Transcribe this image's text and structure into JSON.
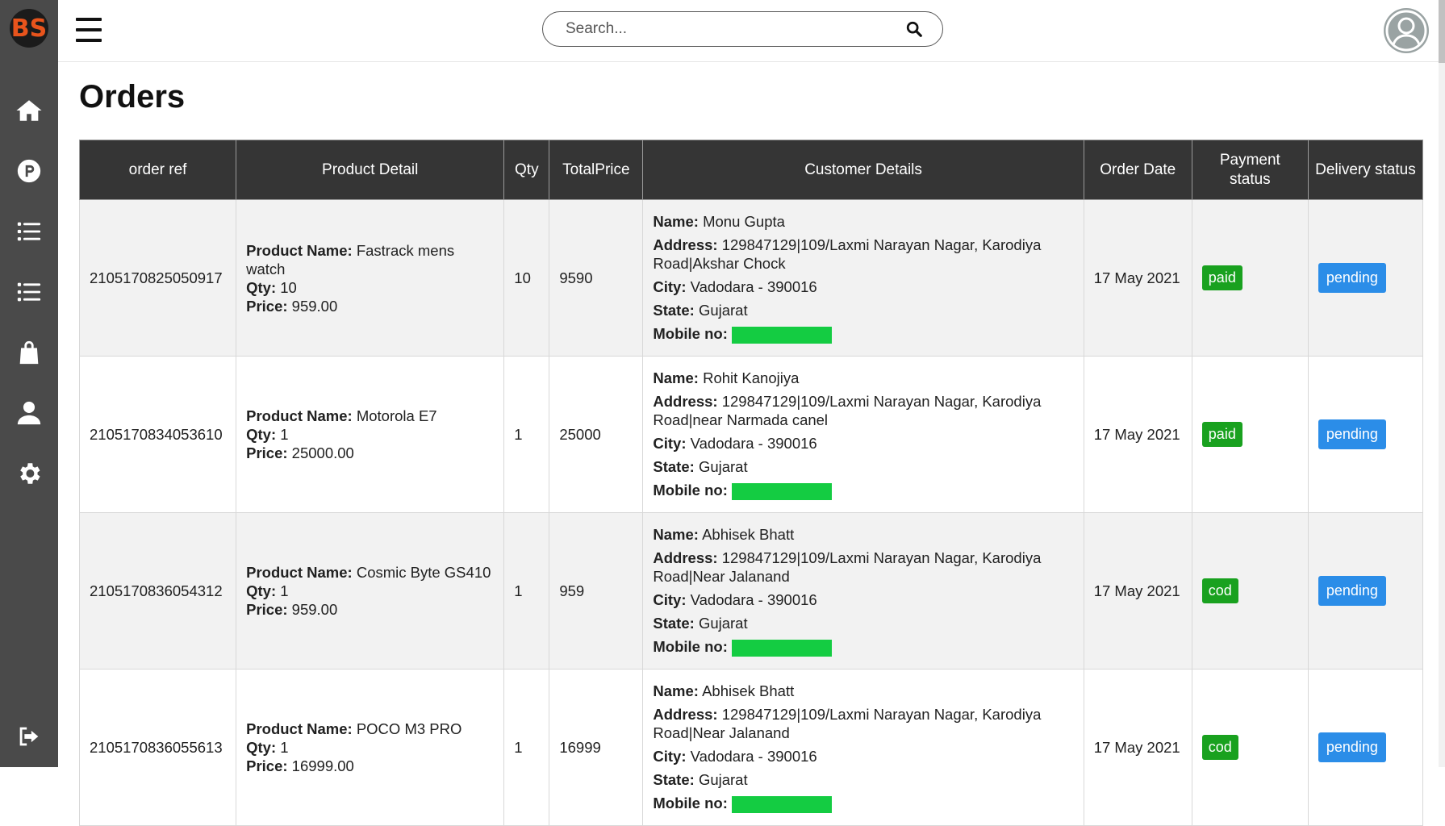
{
  "app": {
    "logo_text": "BS"
  },
  "sidebar": {
    "items": [
      {
        "icon": "home-icon"
      },
      {
        "icon": "product-p-icon"
      },
      {
        "icon": "list-icon"
      },
      {
        "icon": "list-alt-icon"
      },
      {
        "icon": "shopping-bag-icon"
      },
      {
        "icon": "user-icon"
      },
      {
        "icon": "gear-icon"
      },
      {
        "icon": "logout-icon"
      }
    ]
  },
  "search": {
    "placeholder": "Search..."
  },
  "page": {
    "title": "Orders"
  },
  "table": {
    "headers": [
      "order ref",
      "Product Detail",
      "Qty",
      "TotalPrice",
      "Customer Details",
      "Order Date",
      "Payment status",
      "Delivery status"
    ],
    "labels": {
      "product_name": "Product Name:",
      "qty": "Qty:",
      "price": "Price:",
      "name": "Name:",
      "address": "Address:",
      "city": "City:",
      "state": "State:",
      "mobile": "Mobile no:"
    },
    "rows": [
      {
        "order_ref": "2105170825050917",
        "product_name": "Fastrack mens watch",
        "product_qty": "10",
        "product_price": "959.00",
        "qty": "10",
        "total": "9590",
        "name": "Monu Gupta",
        "address": "129847129|109/Laxmi Narayan Nagar, Karodiya Road|Akshar Chock",
        "city": "Vadodara - 390016",
        "state": "Gujarat",
        "date": "17 May 2021",
        "payment": "paid",
        "delivery": "pending"
      },
      {
        "order_ref": "2105170834053610",
        "product_name": "Motorola E7",
        "product_qty": "1",
        "product_price": "25000.00",
        "qty": "1",
        "total": "25000",
        "name": "Rohit Kanojiya",
        "address": "129847129|109/Laxmi Narayan Nagar, Karodiya Road|near Narmada canel",
        "city": "Vadodara - 390016",
        "state": "Gujarat",
        "date": "17 May 2021",
        "payment": "paid",
        "delivery": "pending"
      },
      {
        "order_ref": "2105170836054312",
        "product_name": "Cosmic Byte GS410",
        "product_qty": "1",
        "product_price": "959.00",
        "qty": "1",
        "total": "959",
        "name": "Abhisek Bhatt",
        "address": "129847129|109/Laxmi Narayan Nagar, Karodiya Road|Near Jalanand",
        "city": "Vadodara - 390016",
        "state": "Gujarat",
        "date": "17 May 2021",
        "payment": "cod",
        "delivery": "pending"
      },
      {
        "order_ref": "2105170836055613",
        "product_name": "POCO M3 PRO",
        "product_qty": "1",
        "product_price": "16999.00",
        "qty": "1",
        "total": "16999",
        "name": "Abhisek Bhatt",
        "address": "129847129|109/Laxmi Narayan Nagar, Karodiya Road|Near Jalanand",
        "city": "Vadodara - 390016",
        "state": "Gujarat",
        "date": "17 May 2021",
        "payment": "cod",
        "delivery": "pending"
      }
    ]
  },
  "colors": {
    "sidebar_bg": "#4a4a4a",
    "header_bg": "#353535",
    "paid_badge": "#19a11f",
    "pending_badge": "#2b8de8",
    "redaction": "#14cc42",
    "logo_accent": "#e8541c"
  }
}
